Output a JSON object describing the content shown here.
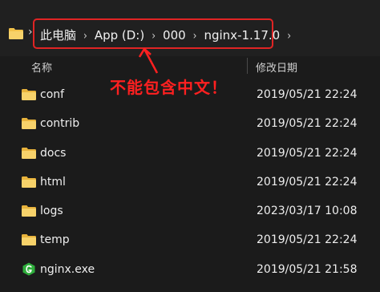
{
  "address_bar": {
    "crumbs": [
      "此电脑",
      "App (D:)",
      "000",
      "nginx-1.17.0"
    ],
    "separator": "›"
  },
  "columns": {
    "name": "名称",
    "date_modified": "修改日期"
  },
  "annotation": {
    "text": "不能包含中文！",
    "color": "#ff2020"
  },
  "files": [
    {
      "name": "conf",
      "date": "2019/05/21 22:24",
      "type": "folder"
    },
    {
      "name": "contrib",
      "date": "2019/05/21 22:24",
      "type": "folder"
    },
    {
      "name": "docs",
      "date": "2019/05/21 22:24",
      "type": "folder"
    },
    {
      "name": "html",
      "date": "2019/05/21 22:24",
      "type": "folder"
    },
    {
      "name": "logs",
      "date": "2023/03/17 10:08",
      "type": "folder"
    },
    {
      "name": "temp",
      "date": "2019/05/21 22:24",
      "type": "folder"
    },
    {
      "name": "nginx.exe",
      "date": "2019/05/21 21:58",
      "type": "exe"
    }
  ],
  "icons": {
    "folder": "folder-icon",
    "exe": "nginx-exe-icon"
  },
  "colors": {
    "folder": "#f2c24a",
    "highlight_border": "#e02424",
    "exe_icon": "#2fae3c"
  }
}
